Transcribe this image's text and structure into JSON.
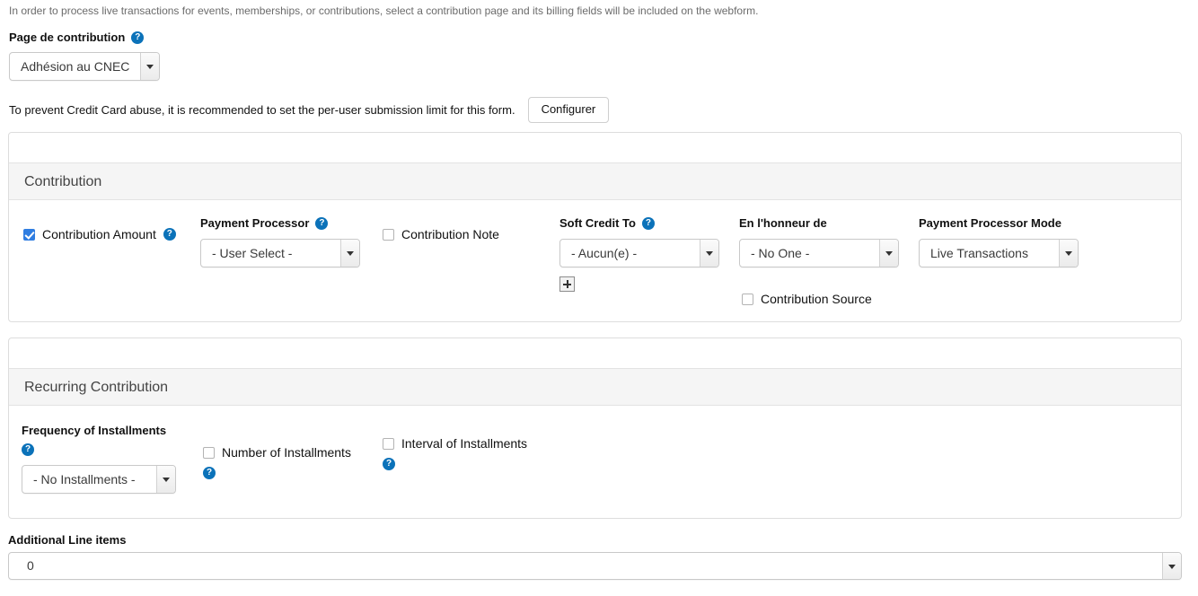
{
  "intro": {
    "text": "In order to process live transactions for events, memberships, or contributions, select a contribution page and its billing fields will be included on the webform."
  },
  "contribution_page": {
    "label": "Page de contribution",
    "help_icon": "help-circle-icon",
    "value": "Adhésion au CNEC"
  },
  "limit_notice": {
    "text": "To prevent Credit Card abuse, it is recommended to set the per-user submission limit for this form.",
    "button_label": "Configurer"
  },
  "contribution_panel": {
    "header": "Contribution",
    "contribution_amount": {
      "label": "Contribution Amount",
      "checked": true,
      "help_icon": "help-circle-icon"
    },
    "payment_processor": {
      "label": "Payment Processor",
      "help_icon": "help-circle-icon",
      "value": "- User Select -"
    },
    "contribution_note": {
      "label": "Contribution Note",
      "checked": false
    },
    "soft_credit_to": {
      "label": "Soft Credit To",
      "help_icon": "help-circle-icon",
      "value": "- Aucun(e) -",
      "add_button": "plus-icon"
    },
    "en_l_honneur_de": {
      "label": "En l'honneur de",
      "value": "- No One -"
    },
    "payment_processor_mode": {
      "label": "Payment Processor Mode",
      "value": "Live Transactions"
    },
    "contribution_source": {
      "label": "Contribution Source",
      "checked": false
    }
  },
  "recurring_panel": {
    "header": "Recurring Contribution",
    "frequency_of_installments": {
      "label": "Frequency of Installments",
      "help_icon": "help-circle-icon",
      "value": "- No Installments -"
    },
    "number_of_installments": {
      "label": "Number of Installments",
      "checked": false,
      "help_icon": "help-circle-icon"
    },
    "interval_of_installments": {
      "label": "Interval of Installments",
      "checked": false,
      "help_icon": "help-circle-icon"
    }
  },
  "additional_line_items": {
    "label": "Additional Line items",
    "value": "0"
  },
  "colors": {
    "help_blue": "#0b72b9",
    "checkbox_blue": "#2f7de1",
    "panel_header_bg": "#f5f5f5",
    "panel_border": "#dddddd"
  }
}
